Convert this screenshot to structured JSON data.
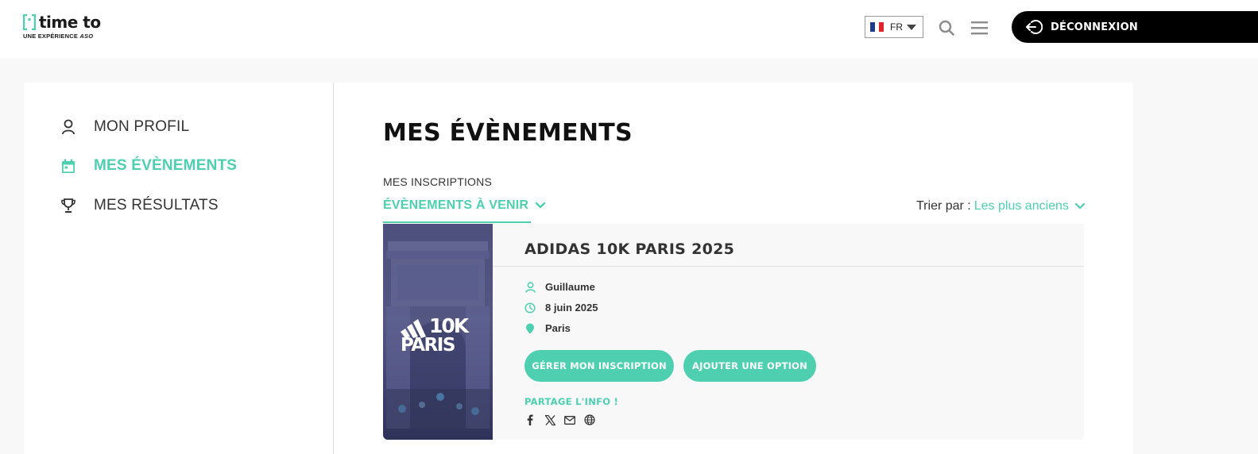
{
  "header": {
    "logo": {
      "name": "time to",
      "tagline_prefix": "UNE EXPÉRIENCE",
      "tagline_brand": "ASO"
    },
    "language": {
      "code": "FR",
      "flag_colors": [
        "#1b3b8f",
        "#ffffff",
        "#e0242b"
      ]
    },
    "logout_label": "DÉCONNEXION"
  },
  "sidebar": {
    "items": [
      {
        "label": "MON PROFIL",
        "icon": "user-icon",
        "active": false
      },
      {
        "label": "MES ÉVÈNEMENTS",
        "icon": "calendar-icon",
        "active": true
      },
      {
        "label": "MES RÉSULTATS",
        "icon": "trophy-icon",
        "active": false
      }
    ]
  },
  "main": {
    "title": "MES ÉVÈNEMENTS",
    "subtitle": "MES INSCRIPTIONS",
    "tab_label": "ÉVÈNEMENTS À VENIR",
    "sort": {
      "label": "Trier par :",
      "value": "Les plus anciens"
    }
  },
  "event": {
    "title": "ADIDAS 10K PARIS 2025",
    "image_logo_line1": "10K",
    "image_logo_line2": "PARIS",
    "participant": "Guillaume",
    "date": "8 juin 2025",
    "location": "Paris",
    "manage_button": "GÉRER MON INSCRIPTION",
    "option_button": "AJOUTER UNE OPTION",
    "share_label": "PARTAGE L'INFO !",
    "share_icons": [
      "facebook-icon",
      "x-icon",
      "mail-icon",
      "globe-icon"
    ]
  },
  "colors": {
    "accent": "#4ecfb0",
    "dark": "#000000"
  }
}
